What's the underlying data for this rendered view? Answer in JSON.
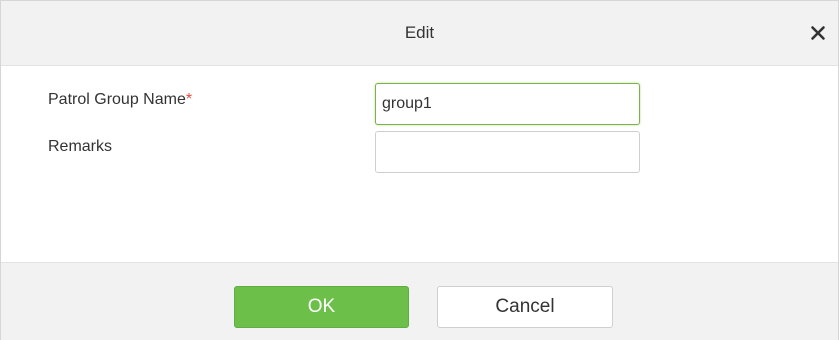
{
  "dialog": {
    "title": "Edit",
    "close_icon": "close-icon"
  },
  "form": {
    "patrol_group_name": {
      "label": "Patrol Group Name",
      "required_marker": "*",
      "value": "group1"
    },
    "remarks": {
      "label": "Remarks",
      "value": ""
    }
  },
  "footer": {
    "ok_label": "OK",
    "cancel_label": "Cancel"
  },
  "colors": {
    "ok_button": "#6cc04a",
    "focus_border": "#7cb342",
    "required": "#e74c3c"
  }
}
